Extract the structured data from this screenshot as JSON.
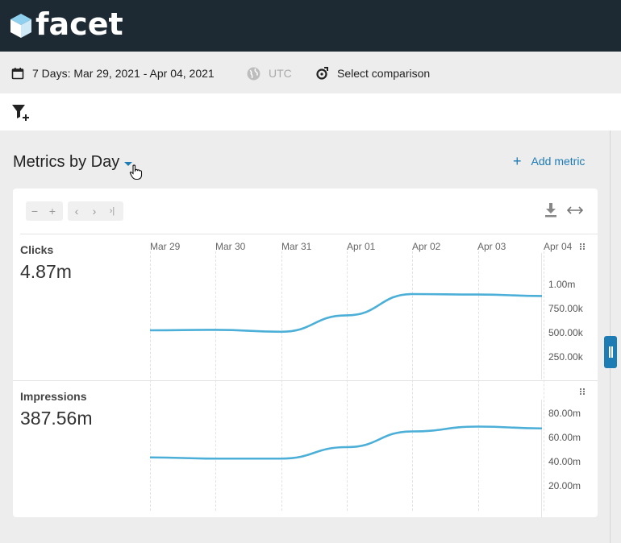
{
  "brand": {
    "name": "facet"
  },
  "toolbar": {
    "date_range": "7 Days: Mar 29, 2021 - Apr 04, 2021",
    "timezone": "UTC",
    "comparison": "Select comparison"
  },
  "section": {
    "title": "Metrics by Day",
    "add_metric": "Add metric"
  },
  "chart_controls": {
    "zoom_out": "−",
    "zoom_in": "+",
    "prev": "‹",
    "next": "›",
    "last": "›|"
  },
  "dates": [
    "Mar 29",
    "Mar 30",
    "Mar 31",
    "Apr 01",
    "Apr 02",
    "Apr 03",
    "Apr 04"
  ],
  "metrics": [
    {
      "name": "Clicks",
      "total": "4.87m",
      "ticks": [
        "1.00m",
        "750.00k",
        "500.00k",
        "250.00k"
      ]
    },
    {
      "name": "Impressions",
      "total": "387.56m",
      "ticks": [
        "80.00m",
        "60.00m",
        "40.00m",
        "20.00m"
      ]
    }
  ],
  "colors": {
    "accent": "#1e7cb5",
    "line": "#4bafd8",
    "topbar": "#1e2a33"
  },
  "chart_data": [
    {
      "type": "line",
      "x": [
        "Mar 29",
        "Mar 30",
        "Mar 31",
        "Apr 01",
        "Apr 02",
        "Apr 03",
        "Apr 04"
      ],
      "series": [
        {
          "name": "Clicks",
          "values": [
            525000,
            530000,
            510000,
            680000,
            900000,
            895000,
            880000
          ]
        }
      ],
      "ylim": [
        0,
        1250000
      ],
      "yticks": [
        "1.00m",
        "750.00k",
        "500.00k",
        "250.00k"
      ]
    },
    {
      "type": "line",
      "x": [
        "Mar 29",
        "Mar 30",
        "Mar 31",
        "Apr 01",
        "Apr 02",
        "Apr 03",
        "Apr 04"
      ],
      "series": [
        {
          "name": "Impressions",
          "values": [
            43500000,
            42500000,
            42500000,
            52000000,
            65000000,
            69000000,
            67500000
          ]
        }
      ],
      "ylim": [
        0,
        100000000
      ],
      "yticks": [
        "80.00m",
        "60.00m",
        "40.00m",
        "20.00m"
      ]
    }
  ]
}
